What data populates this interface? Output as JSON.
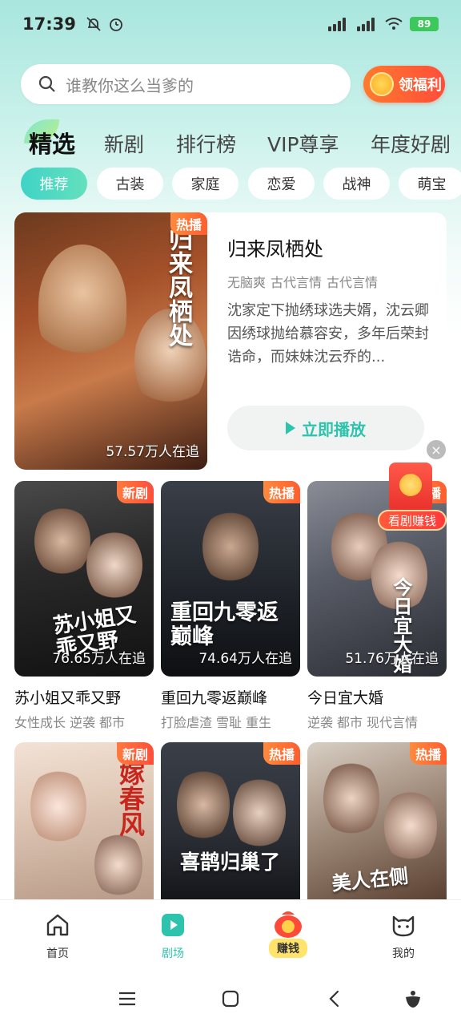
{
  "status_bar": {
    "time": "17:39",
    "battery": "89"
  },
  "search": {
    "placeholder": "谁教你这么当爹的"
  },
  "welfare_button": {
    "label": "领福利"
  },
  "top_tabs": [
    {
      "label": "精选",
      "active": true
    },
    {
      "label": "新剧"
    },
    {
      "label": "排行榜"
    },
    {
      "label": "VIP尊享"
    },
    {
      "label": "年度好剧"
    }
  ],
  "chips": [
    {
      "label": "推荐",
      "active": true
    },
    {
      "label": "古装"
    },
    {
      "label": "家庭"
    },
    {
      "label": "恋爱"
    },
    {
      "label": "战神"
    },
    {
      "label": "萌宝"
    }
  ],
  "featured": {
    "badge": "热播",
    "poster_title": "归来凤栖处",
    "follow": "57.57万人在追",
    "title": "归来凤栖处",
    "tags": [
      "无脑爽",
      "古代言情",
      "古代言情"
    ],
    "description": "沈家定下抛绣球选夫婿，沈云卿因绣球抛给慕容安，多年后荣封诰命，而妹妹沈云乔的...",
    "play_label": "立即播放"
  },
  "close_label": "×",
  "earn_float": {
    "label": "看剧赚钱"
  },
  "grid": [
    {
      "badge": "新剧",
      "badge_type": "new",
      "poster_title": "苏小姐又乖又野",
      "follow": "76.65万人在追",
      "title": "苏小姐又乖又野",
      "tags": [
        "女性成长",
        "逆袭",
        "都市"
      ]
    },
    {
      "badge": "热播",
      "badge_type": "hot",
      "poster_title": "重回九零返巅峰",
      "follow": "74.64万人在追",
      "title": "重回九零返巅峰",
      "tags": [
        "打脸虐渣",
        "雪耻",
        "重生"
      ]
    },
    {
      "badge": "热播",
      "badge_type": "hot",
      "poster_title": "今日宜大婚",
      "follow": "51.76万人在追",
      "title": "今日宜大婚",
      "tags": [
        "逆袭",
        "都市",
        "现代言情"
      ]
    },
    {
      "badge": "新剧",
      "badge_type": "new",
      "poster_title": "嫁春风",
      "follow": "",
      "title": "",
      "tags": []
    },
    {
      "badge": "热播",
      "badge_type": "hot",
      "poster_title": "喜鹊归巢了",
      "follow": "",
      "title": "",
      "tags": []
    },
    {
      "badge": "热播",
      "badge_type": "hot",
      "poster_title": "美人在侧",
      "follow": "",
      "title": "",
      "tags": []
    }
  ],
  "bottom_nav": [
    {
      "label": "首页",
      "icon": "home-icon"
    },
    {
      "label": "剧场",
      "icon": "theater-icon",
      "active": true
    },
    {
      "label": "赚钱",
      "icon": "money-bag-icon"
    },
    {
      "label": "我的",
      "icon": "cat-profile-icon"
    }
  ],
  "colors": {
    "accent": "#2ec3ad",
    "hot_badge": "#ff6a33",
    "welfare": "#ff5a36"
  }
}
